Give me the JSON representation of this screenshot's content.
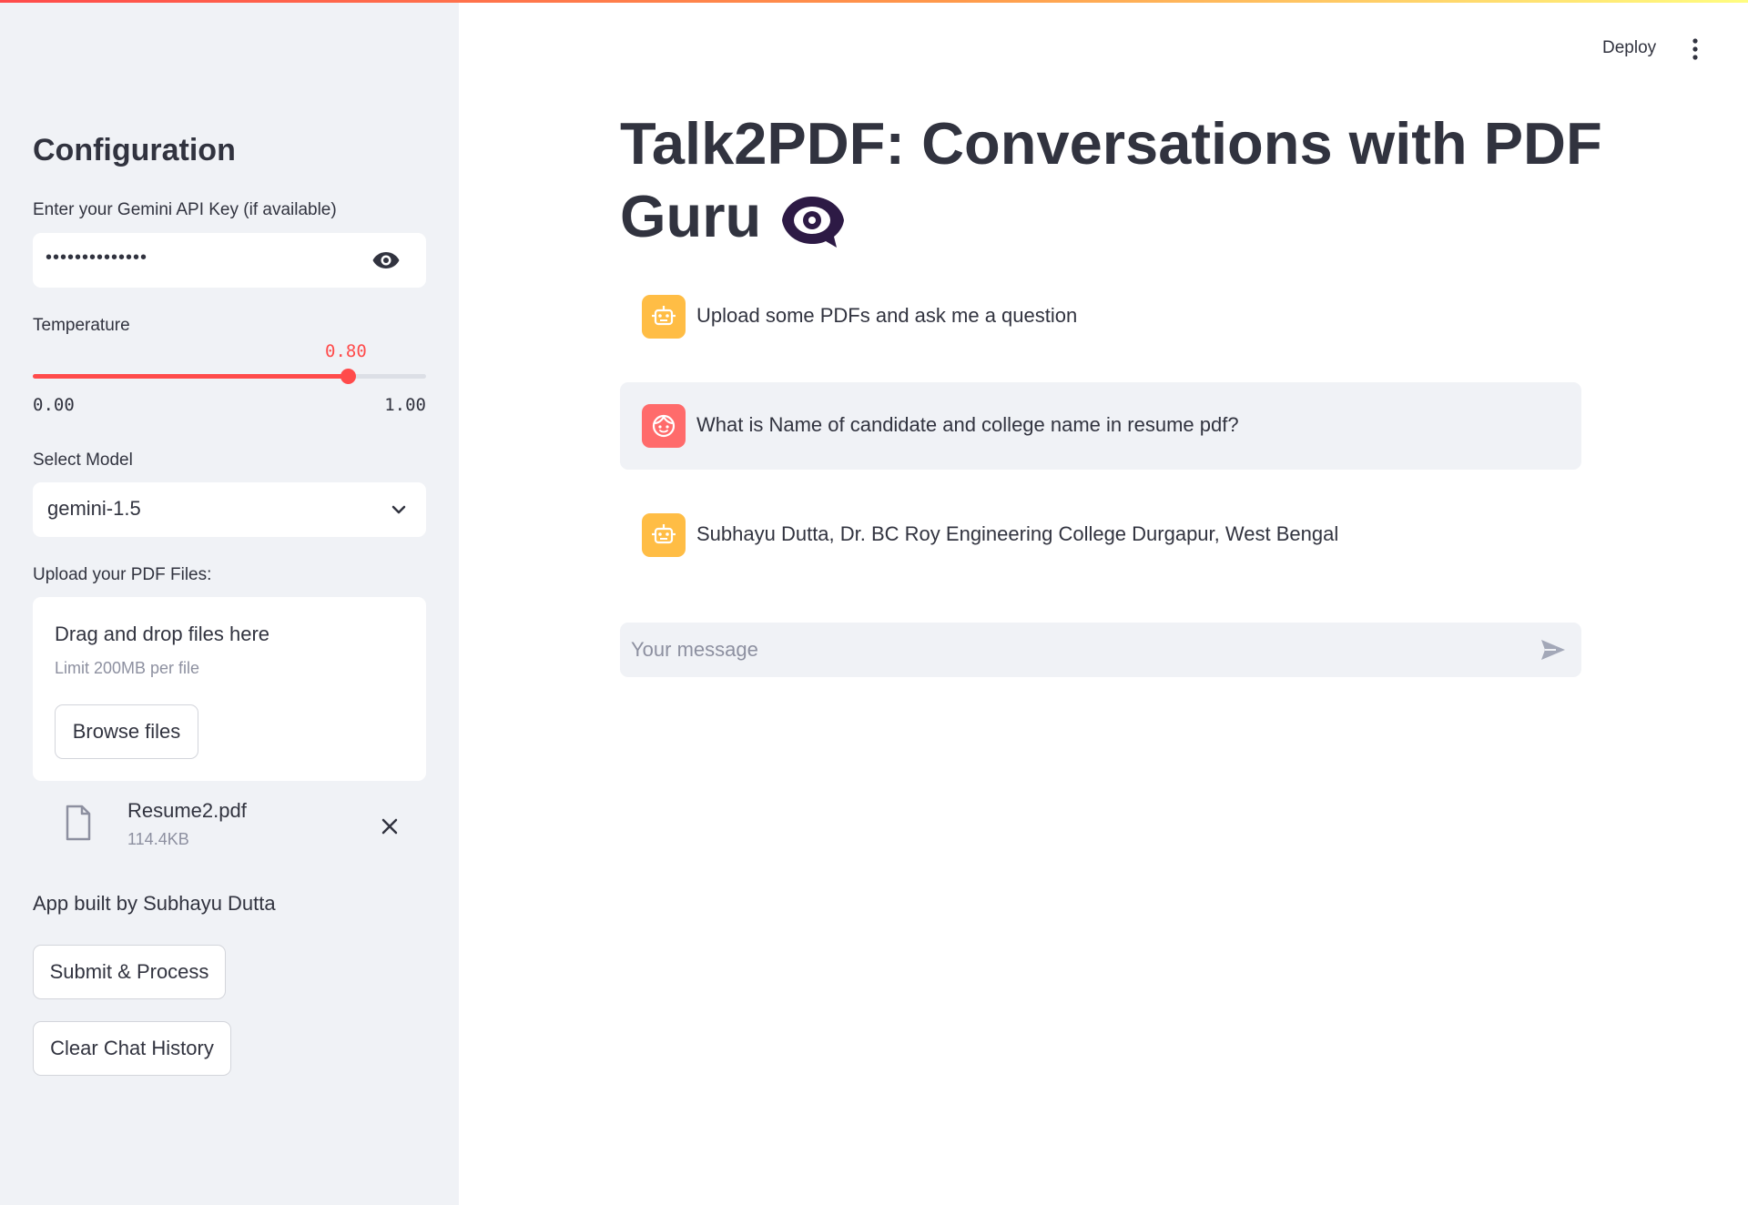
{
  "header": {
    "deploy_label": "Deploy"
  },
  "sidebar": {
    "heading": "Configuration",
    "api_key": {
      "label": "Enter your Gemini API Key (if available)",
      "value": "••••••••••••••"
    },
    "temperature": {
      "label": "Temperature",
      "value": 0.8,
      "value_text": "0.80",
      "min_text": "0.00",
      "max_text": "1.00"
    },
    "model": {
      "label": "Select Model",
      "value": "gemini-1.5"
    },
    "upload": {
      "label": "Upload your PDF Files:",
      "drop_title": "Drag and drop files here",
      "limit": "Limit 200MB per file",
      "browse_label": "Browse files",
      "files": [
        {
          "name": "Resume2.pdf",
          "size": "114.4KB"
        }
      ]
    },
    "built_by": "App built by Subhayu Dutta",
    "submit_label": "Submit & Process",
    "clear_label": "Clear Chat History"
  },
  "main": {
    "title_line1": "Talk2PDF: Conversations with PDF",
    "title_line2": "Guru",
    "messages": [
      {
        "role": "assistant",
        "text": "Upload some PDFs and ask me a question"
      },
      {
        "role": "user",
        "text": "What is Name of candidate and college name in resume pdf?"
      },
      {
        "role": "assistant",
        "text": "Subhayu Dutta, Dr. BC Roy Engineering College Durgapur, West Bengal"
      }
    ],
    "chat_input": {
      "placeholder": "Your message"
    }
  },
  "colors": {
    "accent": "#ff4b4b",
    "sidebar_bg": "#f0f2f6",
    "bot_avatar": "#ffbd45",
    "user_avatar": "#ff6b6b",
    "text": "#31333f"
  }
}
